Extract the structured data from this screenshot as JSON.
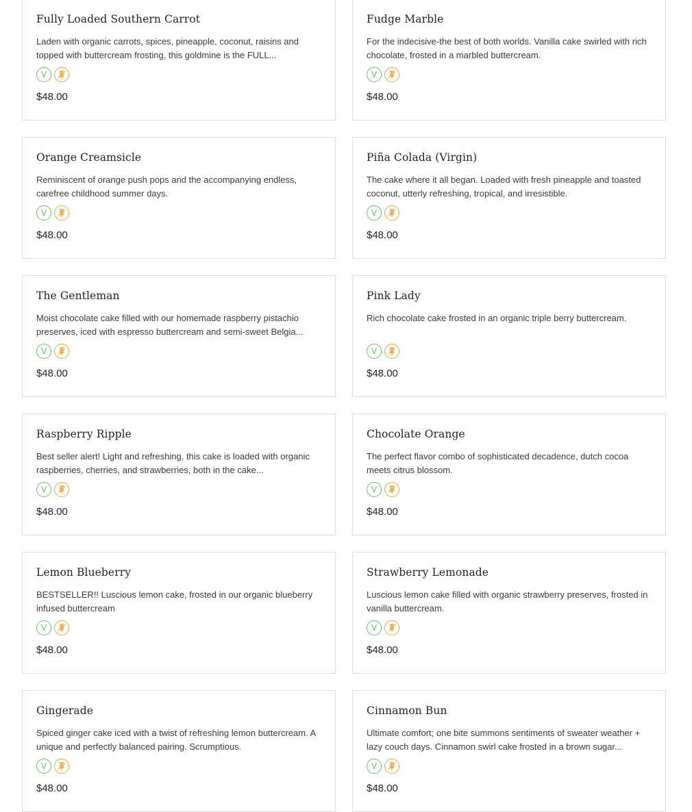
{
  "badges": {
    "vegan_label": "V",
    "vegan_color": "#6cc070",
    "gluten_free_color": "#f0a73a",
    "vegan_icon": "vegan-v-icon",
    "gluten_free_icon": "wheat-free-icon"
  },
  "products": [
    {
      "name": "Fully Loaded Southern Carrot",
      "description": "Laden with organic carrots, spices, pineapple, coconut, raisins and topped with buttercream frosting, this goldmine is the FULL...",
      "price": "$48.00"
    },
    {
      "name": "Fudge Marble",
      "description": "For the indecisive-the best of both worlds. Vanilla cake swirled with rich chocolate, frosted in a marbled buttercream.",
      "price": "$48.00"
    },
    {
      "name": "Orange Creamsicle",
      "description": "Reminiscent of orange push pops and the accompanying endless, carefree childhood summer days.",
      "price": "$48.00"
    },
    {
      "name": "Piña Colada (Virgin)",
      "description": "The cake where it all began. Loaded with fresh pineapple and toasted coconut, utterly refreshing, tropical, and irresistible.",
      "price": "$48.00"
    },
    {
      "name": "The Gentleman",
      "description": "Moist chocolate cake filled with our homemade raspberry pistachio preserves, iced with espresso buttercream and semi-sweet Belgia...",
      "price": "$48.00"
    },
    {
      "name": "Pink Lady",
      "description": "Rich chocolate cake frosted in an organic triple berry buttercream.",
      "price": "$48.00"
    },
    {
      "name": "Raspberry Ripple",
      "description": "Best seller alert! Light and refreshing, this cake is loaded with organic raspberries, cherries, and strawberries, both in the cake...",
      "price": "$48.00"
    },
    {
      "name": "Chocolate Orange",
      "description": "The perfect flavor combo of sophisticated decadence, dutch cocoa meets citrus blossom.",
      "price": "$48.00"
    },
    {
      "name": "Lemon Blueberry",
      "description": "BESTSELLER!! Luscious lemon cake, frosted in our organic blueberry infused buttercream",
      "price": "$48.00"
    },
    {
      "name": "Strawberry Lemonade",
      "description": "Luscious lemon cake filled with organic strawberry preserves, frosted in vanilla buttercream.",
      "price": "$48.00"
    },
    {
      "name": "Gingerade",
      "description": "Spiced ginger cake iced with a twist of refreshing lemon buttercream. A unique and perfectly balanced pairing. Scrumptious.",
      "price": "$48.00"
    },
    {
      "name": "Cinnamon Bun",
      "description": "Ultimate comfort; one bite summons sentiments of sweater weather + lazy couch days. Cinnamon swirl cake frosted in a brown sugar...",
      "price": "$48.00"
    }
  ]
}
